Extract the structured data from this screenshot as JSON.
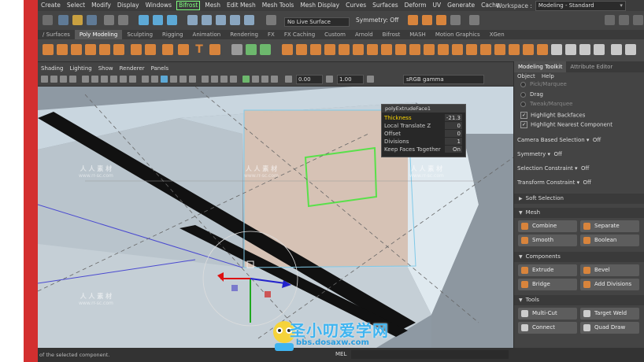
{
  "menubar": {
    "items": [
      "Create",
      "Select",
      "Modify",
      "Display",
      "Windows",
      "Bifrost",
      "Mesh",
      "Edit Mesh",
      "Mesh Tools",
      "Mesh Display",
      "Curves",
      "Surfaces",
      "Deform",
      "UV",
      "Generate",
      "Cache"
    ],
    "workspace_label": "Workspace :",
    "workspace_value": "Modeling - Standard"
  },
  "statusline": {
    "live_surface": "No Live Surface",
    "symmetry": "Symmetry: Off"
  },
  "shelf_tabs": [
    "/ Surfaces",
    "Poly Modeling",
    "Sculpting",
    "Rigging",
    "Animation",
    "Rendering",
    "FX",
    "FX Caching",
    "Custom",
    "Arnold",
    "Bifrost",
    "MASH",
    "Motion Graphics",
    "XGen"
  ],
  "viewport": {
    "menus": [
      "Shading",
      "Lighting",
      "Show",
      "Renderer",
      "Panels"
    ],
    "val_a": "0.00",
    "val_b": "1.00",
    "colorspace": "sRGB gamma"
  },
  "popup": {
    "title": "polyExtrudeFace1",
    "rows": [
      {
        "label": "Thickness",
        "value": "-21.3"
      },
      {
        "label": "Local Translate Z",
        "value": "0"
      },
      {
        "label": "Offset",
        "value": "0"
      },
      {
        "label": "Divisions",
        "value": "1"
      },
      {
        "label": "Keep Faces Together",
        "value": "On"
      }
    ]
  },
  "panel": {
    "tabs": [
      "Modeling Toolkit",
      "Attribute Editor"
    ],
    "menu": [
      "Object",
      "Help"
    ],
    "pick_marquee": "Pick/Marquee",
    "drag": "Drag",
    "tweak_marquee": "Tweak/Marquee",
    "highlight_backfaces": "Highlight Backfaces",
    "highlight_nearest": "Highlight Nearest Component",
    "camera_selection_label": "Camera Based Selection",
    "camera_selection_value": "Off",
    "symmetry_label": "Symmetry",
    "symmetry_value": "Off",
    "selection_constraint_label": "Selection Constraint",
    "selection_constraint_value": "Off",
    "transform_constraint_label": "Transform Constraint",
    "transform_constraint_value": "Off",
    "soft_selection": "Soft Selection",
    "mesh_section": "Mesh",
    "combine": "Combine",
    "separate": "Separate",
    "smooth": "Smooth",
    "boolean": "Boolean",
    "components_section": "Components",
    "extrude": "Extrude",
    "bevel": "Bevel",
    "bridge": "Bridge",
    "add_divisions": "Add Divisions",
    "tools_section": "Tools",
    "multi_cut": "Multi-Cut",
    "target_weld": "Target Weld",
    "connect": "Connect",
    "quad_draw": "Quad Draw"
  },
  "footer": {
    "help": "of the selected component.",
    "mel": "MEL"
  },
  "watermark": {
    "cn": "人 人 素 材",
    "url": "www.rr-sc.com",
    "brand_cn": "圣小叨爱学网",
    "brand_url": "bbs.dosaxw.com"
  }
}
